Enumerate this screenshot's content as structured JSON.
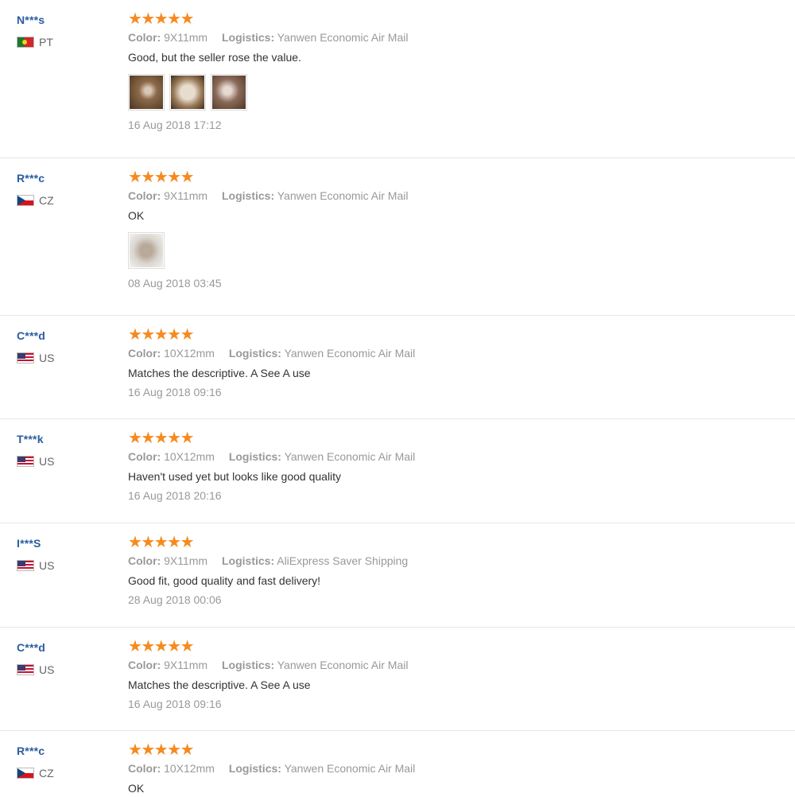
{
  "labels": {
    "color": "Color:",
    "logistics": "Logistics:"
  },
  "rating_star_glyph": "★",
  "colors": {
    "username": "#2a5d9f",
    "star": "#f68a1f",
    "muted": "#999999",
    "text": "#333333"
  },
  "reviews": [
    {
      "user": "N***s",
      "country": "PT",
      "rating": 5,
      "color": "9X11mm",
      "logistics": "Yanwen Economic Air Mail",
      "feedback": "Good, but the seller rose the value.",
      "photos": [
        "photo-1",
        "photo-2",
        "photo-3"
      ],
      "date": "16 Aug 2018 17:12"
    },
    {
      "user": "R***c",
      "country": "CZ",
      "rating": 5,
      "color": "9X11mm",
      "logistics": "Yanwen Economic Air Mail",
      "feedback": "OK",
      "photos": [
        "photo-1"
      ],
      "date": "08 Aug 2018 03:45"
    },
    {
      "user": "C***d",
      "country": "US",
      "rating": 5,
      "color": "10X12mm",
      "logistics": "Yanwen Economic Air Mail",
      "feedback": "Matches the descriptive. A See A use",
      "photos": [],
      "date": "16 Aug 2018 09:16"
    },
    {
      "user": "T***k",
      "country": "US",
      "rating": 5,
      "color": "10X12mm",
      "logistics": "Yanwen Economic Air Mail",
      "feedback": "Haven't used yet but looks like good quality",
      "photos": [],
      "date": "16 Aug 2018 20:16"
    },
    {
      "user": "I***S",
      "country": "US",
      "rating": 5,
      "color": "9X11mm",
      "logistics": "AliExpress Saver Shipping",
      "feedback": "Good fit, good quality and fast delivery!",
      "photos": [],
      "date": "28 Aug 2018 00:06"
    },
    {
      "user": "C***d",
      "country": "US",
      "rating": 5,
      "color": "9X11mm",
      "logistics": "Yanwen Economic Air Mail",
      "feedback": "Matches the descriptive. A See A use",
      "photos": [],
      "date": "16 Aug 2018 09:16"
    },
    {
      "user": "R***c",
      "country": "CZ",
      "rating": 5,
      "color": "10X12mm",
      "logistics": "Yanwen Economic Air Mail",
      "feedback": "OK",
      "photos": [],
      "date": ""
    }
  ]
}
